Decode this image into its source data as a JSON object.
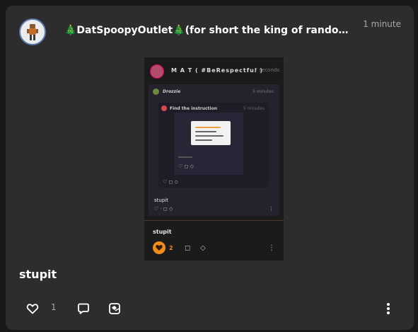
{
  "post": {
    "username": "🎄DatSpoopyOutlet🎄(for short the king of randomness...",
    "timestamp": "1 minute",
    "text": "stupit",
    "like_count": "1"
  },
  "embed": {
    "username": "M A T ( #BeRespectful )",
    "timestamp": "7 seconds",
    "nested_user": "Drozzie",
    "nested_timestamp": "5 minutes",
    "inner_user": "Find the instruction",
    "inner_timestamp": "5 minutes",
    "inner2_text": "stupit",
    "reply_text": "stupit",
    "reply_count": "2"
  },
  "colors": {
    "background": "#191919",
    "card": "#2d2d2d",
    "accent_orange": "#f08c1a",
    "text": "#ffffff",
    "muted": "#a9a9a9"
  },
  "icons": {
    "like": "heart-outline-icon",
    "comment": "speech-bubble-icon",
    "share": "share-card-icon",
    "more": "vertical-ellipsis-icon"
  }
}
